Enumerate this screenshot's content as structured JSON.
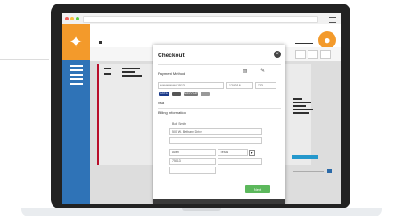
{
  "checkout": {
    "title": "Checkout",
    "close_glyph": "×",
    "payment_method_label": "Payment Method",
    "card_number": "**************1513",
    "expiry": "12/2016",
    "cvv": "123",
    "card_logos": [
      "VISA",
      "",
      "DISCOVER",
      ""
    ],
    "card_type": "visa",
    "billing_label": "Billing Information",
    "billing": {
      "name": "Bob Smith",
      "address1": "500 W. Bethany Drive",
      "address2": "",
      "city": "Allen",
      "state": "Texas",
      "zip": "75013",
      "phone": ""
    },
    "next_label": "Next",
    "footer_left": "",
    "footer_right": ""
  },
  "icons": {
    "logo": "eagle-logo-icon",
    "avatar": "user-avatar-icon",
    "menu": "hamburger-menu-icon",
    "close": "close-icon",
    "card_payment": "credit-card-icon",
    "check_payment": "check-payment-icon"
  },
  "colors": {
    "accent_orange": "#f39a2b",
    "sidebar_blue": "#2f73b7",
    "highlight_red": "#c8102e",
    "next_green": "#5cb85c",
    "info_blue": "#29a5de"
  }
}
